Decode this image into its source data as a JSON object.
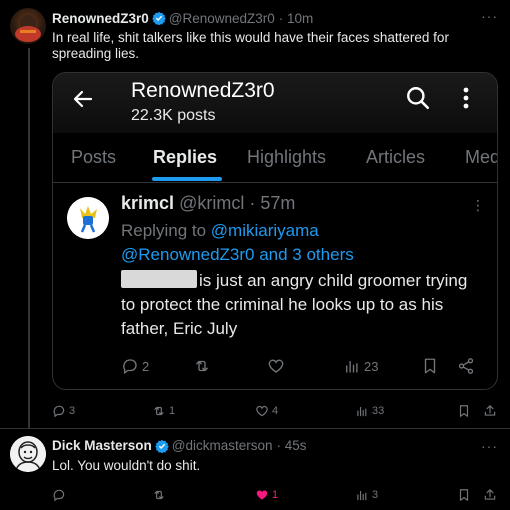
{
  "top_tweet": {
    "author_name": "RenownedZ3r0",
    "handle": "@RenownedZ3r0",
    "time": "· 10m",
    "text": "In real life, shit talkers like this would have their faces shattered for spreading lies.",
    "more_icon": "more-dots-icon",
    "stats": {
      "replies": "3",
      "reposts": "1",
      "likes": "4",
      "views": "33"
    }
  },
  "screenshot": {
    "profile_name": "RenownedZ3r0",
    "profile_posts": "22.3K posts",
    "tabs": [
      "Posts",
      "Replies",
      "Highlights",
      "Articles",
      "Med"
    ],
    "active_tab": "Replies",
    "reply": {
      "author_name": "krimcl",
      "handle": "@krimcl",
      "time": "· 57m",
      "replying_prefix": "Replying to ",
      "replying_to": "@mikiariyama",
      "replying_to_2": "@RenownedZ3r0 and 3 others",
      "text": "is just an angry child groomer trying to protect the criminal he looks up to as his father, Eric July",
      "stats": {
        "replies": "2",
        "views": "23"
      }
    }
  },
  "reply_tweet": {
    "author_name": "Dick Masterson",
    "handle": "@dickmasterson",
    "time": "· 45s",
    "text": "Lol. You wouldn't do shit.",
    "stats": {
      "likes": "1",
      "views": "3"
    }
  },
  "colors": {
    "accent": "#1d9bf0",
    "like": "#f91880",
    "muted": "#71767b",
    "verified": "#1d9bf0"
  }
}
